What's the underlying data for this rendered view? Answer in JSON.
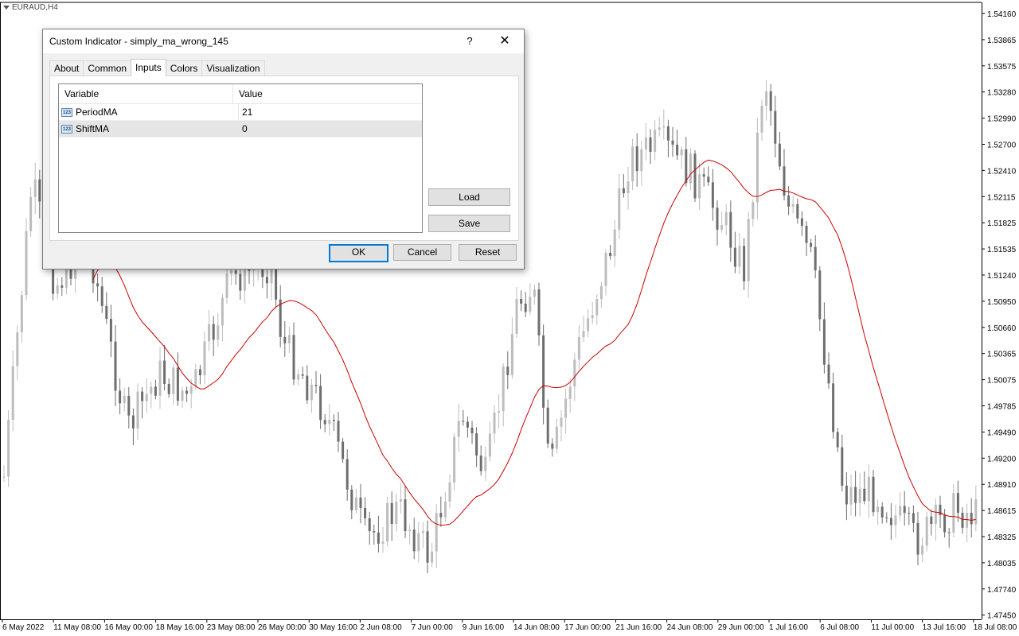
{
  "chart": {
    "symbol": "EURAUD,H4",
    "price_labels": [
      "1.54160",
      "1.53865",
      "1.53575",
      "1.53280",
      "1.52990",
      "1.52700",
      "1.52410",
      "1.52115",
      "1.51825",
      "1.51535",
      "1.51240",
      "1.50950",
      "1.50660",
      "1.50365",
      "1.50075",
      "1.49785",
      "1.49490",
      "1.49200",
      "1.48910",
      "1.48615",
      "1.48325",
      "1.48035",
      "1.47740",
      "1.47450"
    ],
    "time_labels": [
      "6 May 2022",
      "11 May 08:00",
      "16 May 00:00",
      "18 May 16:00",
      "23 May 08:00",
      "26 May 00:00",
      "30 May 16:00",
      "2 Jun 08:00",
      "7 Jun 00:00",
      "9 Jun 16:00",
      "14 Jun 08:00",
      "17 Jun 00:00",
      "21 Jun 16:00",
      "24 Jun 08:00",
      "29 Jun 00:00",
      "1 Jul 16:00",
      "6 Jul 08:00",
      "11 Jul 00:00",
      "13 Jul 16:00",
      "18 Jul 08:00"
    ],
    "ma_color": "#cc0000",
    "bull_color": "#bdbdbd",
    "bear_color": "#6e6e6e"
  },
  "dialog": {
    "title": "Custom Indicator - simply_ma_wrong_145",
    "help": "?",
    "close": "✕",
    "tabs": [
      "About",
      "Common",
      "Inputs",
      "Colors",
      "Visualization"
    ],
    "active_tab": "Inputs",
    "table": {
      "col_variable": "Variable",
      "col_value": "Value",
      "rows": [
        {
          "icon": "123",
          "variable": "PeriodMA",
          "value": "21"
        },
        {
          "icon": "123",
          "variable": "ShiftMA",
          "value": "0"
        }
      ]
    },
    "load_label": "Load",
    "save_label": "Save",
    "ok_label": "OK",
    "cancel_label": "Cancel",
    "reset_label": "Reset"
  }
}
